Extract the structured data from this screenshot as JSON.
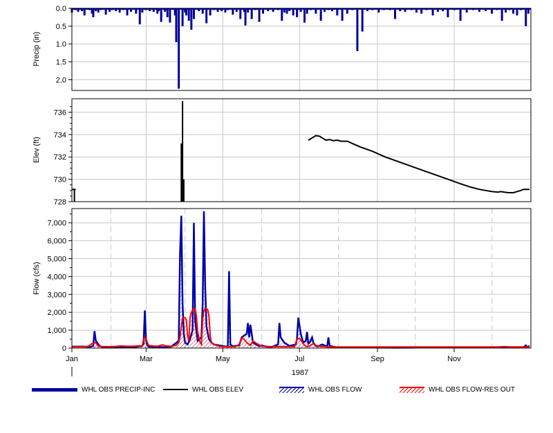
{
  "chart_data": [
    {
      "type": "bar",
      "panel": "precip",
      "ylabel": "Precip (in)",
      "ylim": [
        2.3,
        0.0
      ],
      "y_inverted": true,
      "yticks": [
        0.0,
        0.5,
        1.0,
        1.5,
        2.0
      ],
      "ytick_labels": [
        "0.0",
        "0.5",
        "1.0",
        "1.5",
        "2.0"
      ],
      "grid": true,
      "color": "#00009c",
      "series": [
        {
          "name": "WHL OBS PRECIP-INC",
          "x": [
            1,
            4,
            6,
            9,
            11,
            15,
            17,
            18,
            20,
            22,
            24,
            28,
            31,
            33,
            36,
            39,
            42,
            45,
            48,
            52,
            55,
            57,
            60,
            63,
            66,
            69,
            70,
            72,
            75,
            77,
            79,
            83,
            84,
            86,
            89,
            91,
            92,
            94,
            96,
            98,
            102,
            105,
            108,
            111,
            114,
            117,
            120,
            123,
            125,
            129,
            132,
            135,
            138,
            139,
            141,
            144,
            147,
            150,
            153,
            157,
            161,
            165,
            168,
            170,
            172,
            174,
            177,
            180,
            183,
            186,
            188,
            191,
            195,
            199,
            202,
            205,
            208,
            212,
            216,
            220,
            224,
            228,
            232,
            236,
            240,
            245,
            249,
            254,
            258,
            262,
            266,
            271,
            275,
            279,
            283,
            288,
            292,
            296,
            300,
            305,
            310,
            315,
            320,
            325,
            330,
            335,
            339,
            343,
            346,
            349,
            352,
            355,
            358,
            362,
            364
          ],
          "values": [
            0.12,
            0.05,
            0.1,
            0.08,
            0.2,
            0.05,
            0.15,
            0.25,
            0.08,
            0.12,
            0.05,
            0.18,
            0.1,
            0.05,
            0.08,
            0.12,
            0.05,
            0.2,
            0.1,
            0.15,
            0.45,
            0.12,
            0.05,
            0.08,
            0.1,
            0.15,
            0.08,
            0.38,
            0.1,
            0.25,
            0.4,
            0.2,
            0.95,
            2.25,
            0.5,
            0.12,
            0.2,
            0.35,
            0.6,
            0.3,
            0.08,
            0.15,
            0.42,
            0.2,
            0.05,
            0.1,
            0.08,
            0.12,
            0.05,
            0.18,
            0.1,
            0.3,
            0.1,
            0.48,
            0.12,
            0.3,
            0.05,
            0.38,
            0.15,
            0.08,
            0.1,
            0.05,
            0.35,
            0.12,
            0.15,
            0.08,
            0.2,
            0.25,
            0.1,
            0.4,
            0.15,
            0.05,
            0.15,
            0.35,
            0.1,
            0.05,
            0.08,
            0.2,
            0.35,
            0.15,
            0.05,
            1.2,
            0.65,
            0.08,
            0.05,
            0.12,
            0.05,
            0.05,
            0.3,
            0.08,
            0.1,
            0.05,
            0.12,
            0.15,
            0.05,
            0.2,
            0.1,
            0.08,
            0.25,
            0.05,
            0.35,
            0.12,
            0.05,
            0.1,
            0.08,
            0.15,
            0.05,
            0.35,
            0.12,
            0.05,
            0.15,
            0.2,
            0.05,
            0.5,
            0.15
          ]
        }
      ]
    },
    {
      "type": "line",
      "panel": "elev",
      "ylabel": "Elev (ft)",
      "ylim": [
        728,
        737.2
      ],
      "yticks": [
        728,
        730,
        732,
        734,
        736
      ],
      "ytick_labels": [
        "728",
        "730",
        "732",
        "734",
        "736"
      ],
      "grid": true,
      "color": "#000000",
      "series": [
        {
          "name": "WHL OBS ELEV",
          "segments": [
            {
              "x": [
                1,
                4
              ],
              "y": [
                729.1,
                729.1
              ]
            },
            {
              "x": [
                189,
                190,
                192,
                195,
                198,
                200,
                203,
                206,
                209,
                212,
                215,
                220,
                230,
                240,
                250,
                260,
                270,
                280,
                290,
                300,
                310,
                318,
                325,
                330,
                335,
                340,
                342,
                345,
                348,
                350,
                352,
                355,
                358,
                360,
                365
              ],
              "y": [
                733.5,
                733.55,
                733.7,
                733.9,
                733.85,
                733.7,
                733.5,
                733.55,
                733.45,
                733.5,
                733.4,
                733.4,
                732.9,
                732.5,
                732.0,
                731.6,
                731.2,
                730.8,
                730.4,
                730.0,
                729.6,
                729.3,
                729.1,
                729.0,
                728.9,
                728.85,
                728.9,
                728.85,
                728.8,
                728.8,
                728.8,
                728.9,
                729.0,
                729.1,
                729.1
              ]
            }
          ],
          "spikes": [
            {
              "x": 3,
              "y": 729.1
            },
            {
              "x": 59,
              "y": 728.0
            },
            {
              "x": 88,
              "y": 733.2
            },
            {
              "x": 89,
              "y": 737.0
            },
            {
              "x": 90,
              "y": 730.0
            },
            {
              "x": 91,
              "y": 728.0
            }
          ]
        }
      ]
    },
    {
      "type": "line",
      "panel": "flow",
      "ylabel": "Flow (cfs)",
      "ylim": [
        0,
        7800
      ],
      "yticks": [
        0,
        1000,
        2000,
        3000,
        4000,
        5000,
        6000,
        7000
      ],
      "ytick_labels": [
        "0",
        "1,000",
        "2,000",
        "3,000",
        "4,000",
        "5,000",
        "6,000",
        "7,000"
      ],
      "xlabel": "1987",
      "xlim": [
        1,
        366
      ],
      "xticks": [
        1,
        60,
        121,
        182,
        244,
        305
      ],
      "xtick_labels": [
        "Jan",
        "Mar",
        "May",
        "Jul",
        "Sep",
        "Nov"
      ],
      "minor_gridlines": [
        32,
        91,
        152,
        213,
        274,
        335
      ],
      "grid": true,
      "series": [
        {
          "name": "WHL OBS FLOW",
          "color": "#0000a8",
          "x": [
            1,
            10,
            15,
            18,
            19,
            20,
            23,
            25,
            32,
            33,
            35,
            40,
            50,
            57,
            58,
            59,
            60,
            61,
            62,
            68,
            75,
            80,
            86,
            87,
            88,
            89,
            90,
            91,
            93,
            95,
            97,
            98,
            99,
            101,
            104,
            105,
            106,
            107,
            108,
            110,
            112,
            114,
            118,
            122,
            125,
            126,
            127,
            129,
            134,
            136,
            140,
            141,
            142,
            143,
            145,
            150,
            152,
            154,
            156,
            160,
            165,
            166,
            167,
            170,
            174,
            179,
            180,
            181,
            183,
            185,
            187,
            188,
            189,
            190,
            192,
            193,
            195,
            197,
            200,
            204,
            205,
            206,
            210,
            212,
            215,
            220,
            240,
            260,
            280,
            300,
            320,
            340,
            350,
            360,
            362,
            363,
            365
          ],
          "y": [
            80,
            90,
            60,
            120,
            950,
            400,
            120,
            60,
            50,
            80,
            40,
            40,
            50,
            120,
            250,
            2100,
            400,
            150,
            80,
            60,
            50,
            80,
            400,
            5200,
            7400,
            2500,
            800,
            300,
            200,
            500,
            1000,
            7000,
            1500,
            400,
            600,
            2500,
            7650,
            3500,
            1200,
            500,
            300,
            200,
            150,
            100,
            80,
            4300,
            200,
            100,
            150,
            600,
            800,
            1400,
            600,
            1300,
            300,
            100,
            150,
            100,
            80,
            60,
            200,
            1400,
            600,
            300,
            120,
            200,
            500,
            1700,
            800,
            300,
            400,
            900,
            250,
            300,
            600,
            300,
            120,
            100,
            200,
            80,
            600,
            120,
            60,
            40,
            30,
            50,
            30,
            20,
            30,
            30,
            40,
            40,
            30,
            40,
            150,
            60,
            120
          ]
        },
        {
          "name": "WHL OBS FLOW-RES OUT",
          "color": "#ff0000",
          "x": [
            1,
            8,
            12,
            14,
            17,
            20,
            22,
            25,
            30,
            35,
            40,
            45,
            50,
            53,
            57,
            58,
            59,
            60,
            61,
            62,
            65,
            69,
            73,
            76,
            80,
            84,
            86,
            87,
            88,
            89,
            90,
            91,
            92,
            93,
            94,
            95,
            96,
            97,
            98,
            99,
            100,
            101,
            103,
            104,
            105,
            106,
            107,
            108,
            109,
            110,
            111,
            112,
            114,
            116,
            118,
            120,
            122,
            125,
            128,
            131,
            134,
            136,
            138,
            140,
            143,
            145,
            148,
            152,
            156,
            160,
            165,
            170,
            175,
            178,
            180,
            182,
            184,
            186,
            188,
            190,
            193,
            195,
            198,
            200,
            202,
            205,
            210,
            220,
            230,
            260,
            290,
            320,
            340,
            345,
            350,
            355,
            365
          ],
          "y": [
            80,
            80,
            80,
            100,
            250,
            300,
            100,
            80,
            80,
            90,
            120,
            100,
            100,
            120,
            130,
            500,
            600,
            500,
            300,
            150,
            120,
            100,
            180,
            120,
            100,
            150,
            300,
            600,
            1200,
            1700,
            1700,
            1700,
            1600,
            700,
            400,
            1700,
            2000,
            2100,
            2200,
            2200,
            1800,
            900,
            300,
            200,
            1600,
            2100,
            2200,
            2200,
            2150,
            1800,
            700,
            300,
            200,
            150,
            100,
            80,
            80,
            80,
            80,
            80,
            200,
            550,
            500,
            300,
            150,
            400,
            250,
            100,
            80,
            80,
            80,
            80,
            80,
            80,
            500,
            550,
            350,
            150,
            80,
            120,
            250,
            150,
            100,
            80,
            80,
            60,
            60,
            60,
            60,
            60,
            60,
            60,
            60,
            80,
            60,
            70,
            60
          ]
        }
      ]
    }
  ],
  "legend": {
    "items": [
      {
        "label": "WHL OBS PRECIP-INC",
        "color": "#00009c",
        "style": "thick"
      },
      {
        "label": "WHL OBS ELEV",
        "color": "#000000",
        "style": "thin"
      },
      {
        "label": "WHL OBS FLOW",
        "color": "#0000a8",
        "style": "hatched"
      },
      {
        "label": "WHL OBS FLOW-RES OUT",
        "color": "#ff0000",
        "style": "hatched"
      }
    ]
  }
}
